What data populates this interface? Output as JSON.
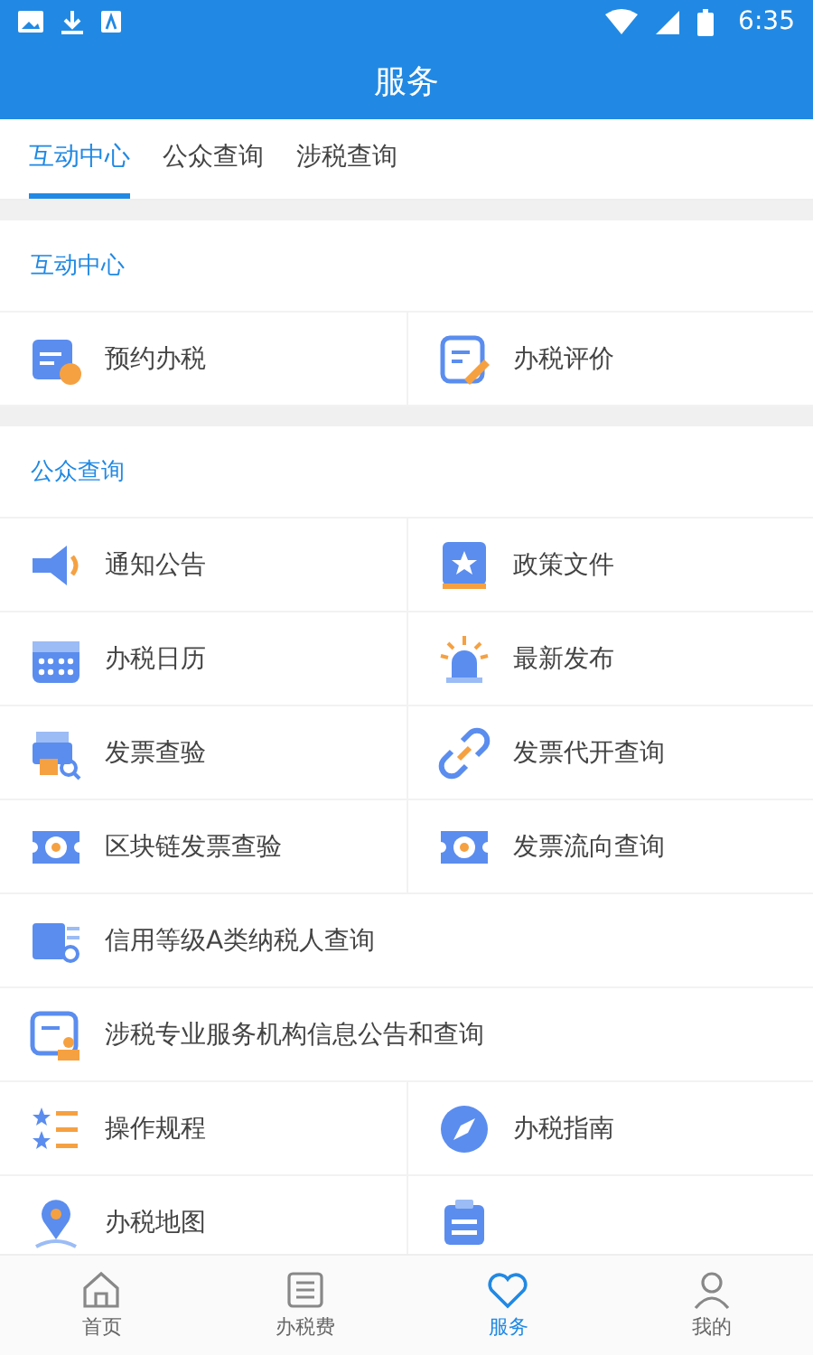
{
  "status_bar": {
    "time": "6:35"
  },
  "header": {
    "title": "服务"
  },
  "tabs": [
    {
      "label": "互动中心",
      "selected": true
    },
    {
      "label": "公众查询",
      "selected": false
    },
    {
      "label": "涉税查询",
      "selected": false
    }
  ],
  "sections": [
    {
      "title": "互动中心",
      "items": [
        {
          "kind": "half",
          "label": "预约办税"
        },
        {
          "kind": "half",
          "label": "办税评价"
        }
      ]
    },
    {
      "title": "公众查询",
      "items": [
        {
          "kind": "half",
          "label": "通知公告"
        },
        {
          "kind": "half",
          "label": "政策文件"
        },
        {
          "kind": "half",
          "label": "办税日历"
        },
        {
          "kind": "half",
          "label": "最新发布"
        },
        {
          "kind": "half",
          "label": "发票查验"
        },
        {
          "kind": "half",
          "label": "发票代开查询"
        },
        {
          "kind": "half",
          "label": "区块链发票查验"
        },
        {
          "kind": "half",
          "label": "发票流向查询"
        },
        {
          "kind": "full",
          "label": "信用等级A类纳税人查询"
        },
        {
          "kind": "full",
          "label": "涉税专业服务机构信息公告和查询"
        },
        {
          "kind": "half",
          "label": "操作规程"
        },
        {
          "kind": "half",
          "label": "办税指南"
        },
        {
          "kind": "half",
          "label": "办税地图"
        },
        {
          "kind": "half"
        }
      ]
    }
  ],
  "bottom_nav": [
    {
      "label": "首页",
      "selected": false
    },
    {
      "label": "办税费",
      "selected": false
    },
    {
      "label": "服务",
      "selected": true
    },
    {
      "label": "我的",
      "selected": false
    }
  ]
}
